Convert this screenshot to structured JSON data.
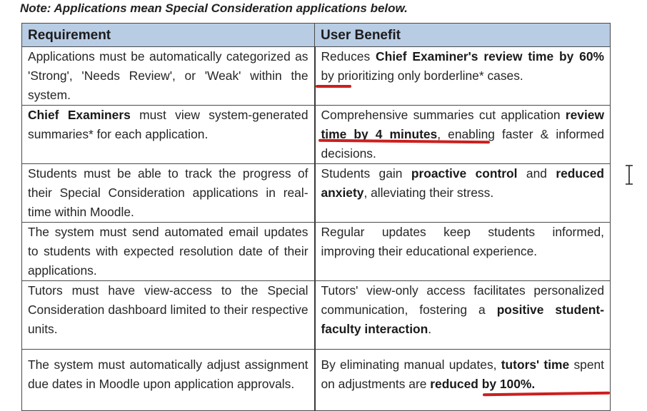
{
  "note": "Note: Applications mean Special Consideration applications below.",
  "table": {
    "headers": [
      "Requirement",
      "User Benefit"
    ],
    "rows": [
      {
        "requirement": [
          "Applications must be automatically categorized as 'Strong', 'Needs Review', or 'Weak' within the system."
        ],
        "benefit": [
          "Reduces ",
          "Chief Examiner's review time by 60%",
          " by prioritizing only borderline* cases."
        ]
      },
      {
        "requirement": [
          "Chief Examiners",
          " must view system-generated summaries* for each application."
        ],
        "benefit": [
          "Comprehensive summaries cut application ",
          "review time by 4 minutes",
          ", enabling faster & informed decisions."
        ]
      },
      {
        "requirement": [
          "Students must be able to track the progress of their Special Consideration applications in real-time within Moodle."
        ],
        "benefit": [
          "Students gain ",
          "proactive control",
          " and ",
          "reduced anxiety",
          ", alleviating their stress."
        ]
      },
      {
        "requirement": [
          "The system must send automated email updates to students with expected resolution date of their applications."
        ],
        "benefit": [
          "Regular updates keep students informed, improving their educational experience."
        ]
      },
      {
        "requirement": [
          "Tutors must have view-access to the Special Consideration dashboard limited to their respective units."
        ],
        "benefit": [
          "Tutors' view-only access facilitates personalized communication, fostering a ",
          "positive student-faculty interaction",
          "."
        ]
      },
      {
        "requirement": [
          "The system must automatically adjust assignment due dates in Moodle upon application approvals."
        ],
        "benefit": [
          "By eliminating manual updates, ",
          "tutors' time",
          " spent on adjustments are ",
          "reduced by 100%."
        ]
      }
    ]
  },
  "colors": {
    "header_bg": "#b8cce4",
    "underline_annotation": "#cc1f1f"
  }
}
